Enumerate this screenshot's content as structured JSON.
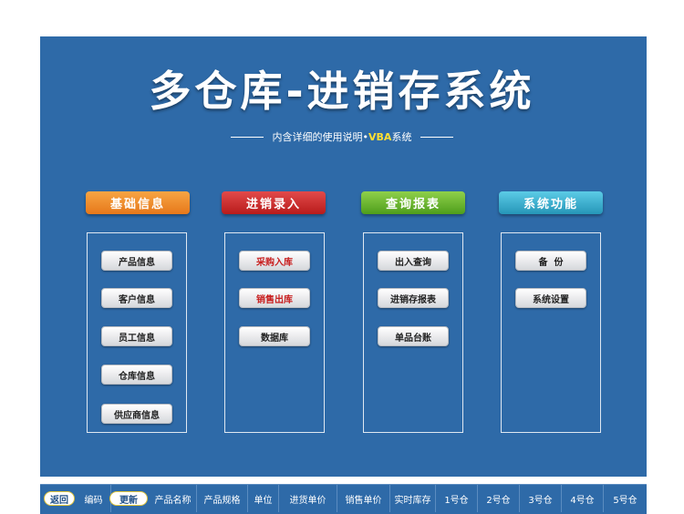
{
  "title": "多仓库-进销存系统",
  "subtitle": {
    "prefix": "内含详细的使用说明•",
    "vba": "VBA",
    "suffix": "系统"
  },
  "categories": [
    {
      "label": "基础信息",
      "color": "#e6781a"
    },
    {
      "label": "进销录入",
      "color": "#b81b1b"
    },
    {
      "label": "查询报表",
      "color": "#4e9e1c"
    },
    {
      "label": "系统功能",
      "color": "#2696b8"
    }
  ],
  "basic": [
    "产品信息",
    "客户信息",
    "员工信息",
    "仓库信息",
    "供应商信息"
  ],
  "entry": [
    "采购入库",
    "销售出库",
    "数据库"
  ],
  "report": [
    "出入查询",
    "进销存报表",
    "单品台账"
  ],
  "system": [
    "备  份",
    "系统设置"
  ],
  "toolbar": {
    "back": "返回",
    "code": "编码",
    "refresh": "更新",
    "columns": [
      "产品名称",
      "产品规格",
      "单位",
      "进货单价",
      "销售单价",
      "实时库存",
      "1号仓",
      "2号仓",
      "3号仓",
      "4号仓",
      "5号仓"
    ]
  }
}
